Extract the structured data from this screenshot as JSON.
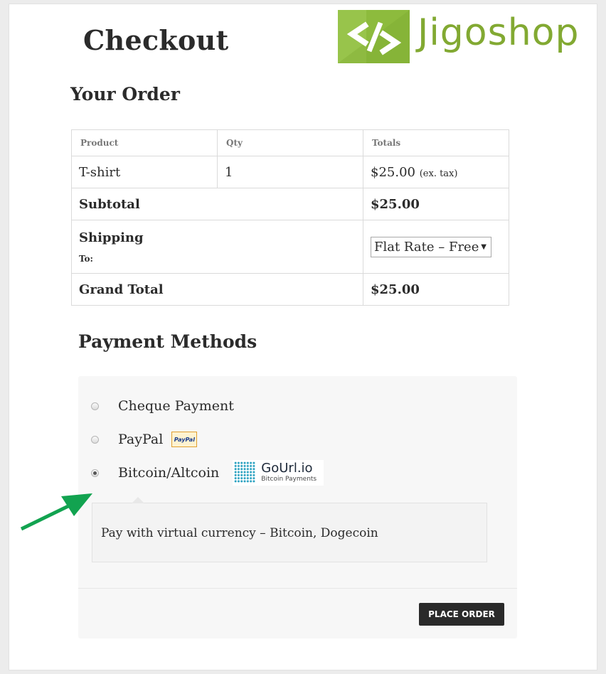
{
  "page": {
    "title": "Checkout"
  },
  "brand": {
    "logo_text": "Jigoshop",
    "accent": "#8dbb3d"
  },
  "order": {
    "heading": "Your Order",
    "columns": [
      "Product",
      "Qty",
      "Totals"
    ],
    "items": [
      {
        "product": "T-shirt",
        "qty": "1",
        "total": "$25.00",
        "tax_note": "(ex. tax)"
      }
    ],
    "subtotal_label": "Subtotal",
    "subtotal_value": "$25.00",
    "shipping_label": "Shipping",
    "shipping_to_label": "To:",
    "shipping_selected": "Flat Rate – Free",
    "grand_total_label": "Grand Total",
    "grand_total_value": "$25.00"
  },
  "payment": {
    "heading": "Payment Methods",
    "methods": [
      {
        "label": "Cheque Payment",
        "selected": false
      },
      {
        "label": "PayPal",
        "selected": false,
        "badge": "PayPal"
      },
      {
        "label": "Bitcoin/Altcoin",
        "selected": true,
        "logo_name": "GoUrl.io",
        "logo_sub": "Bitcoin Payments"
      }
    ],
    "description": "Pay with virtual currency – Bitcoin, Dogecoin",
    "place_order_label": "PLACE ORDER"
  },
  "annotation": {
    "arrow_color": "#12a350"
  }
}
